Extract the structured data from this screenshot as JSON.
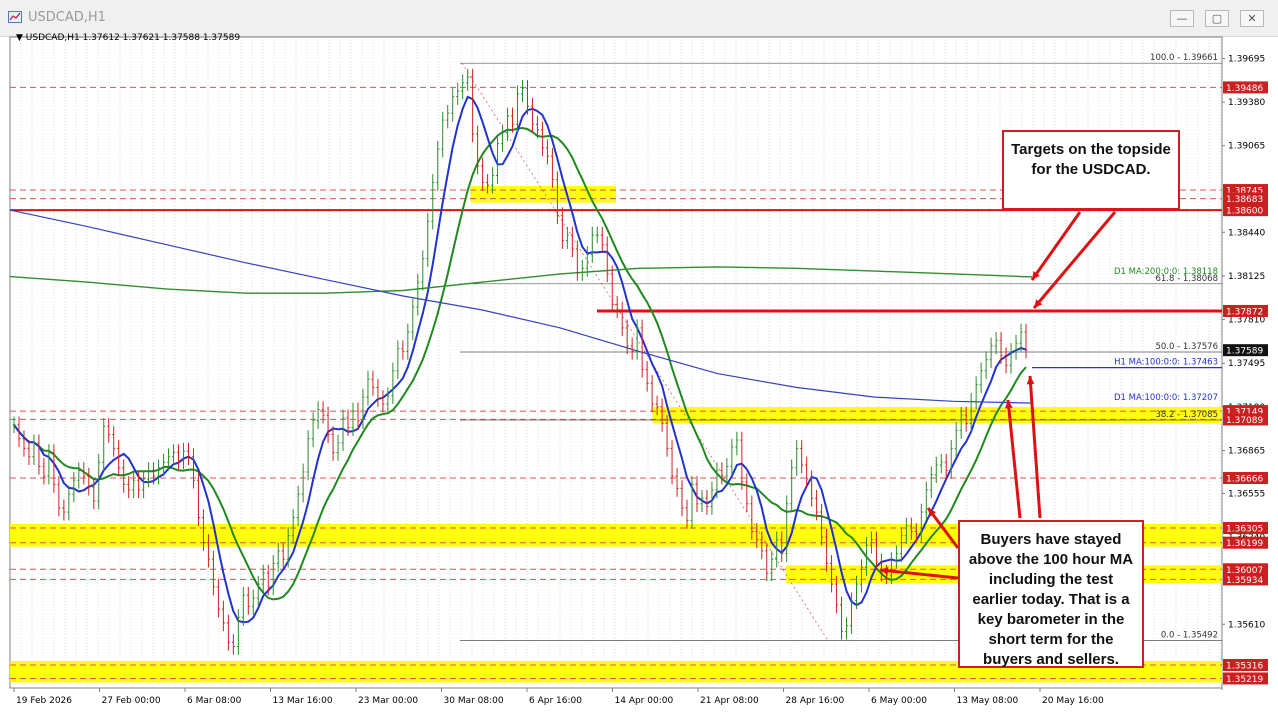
{
  "window": {
    "title": "USDCAD,H1",
    "minimize_label": "—",
    "maximize_label": "▢",
    "close_label": "✕",
    "icon": "chart-window-icon"
  },
  "symbol_header": "▼  USDCAD,H1  1.37612 1.37621 1.37588 1.37589",
  "chart_data": {
    "type": "line",
    "instrument": "USDCAD",
    "timeframe": "H1",
    "price_range": [
      1.3515,
      1.3985
    ],
    "current_price": "1.37589",
    "x_tick_labels": [
      "19 Feb 2026",
      "27 Feb 00:00",
      "6 Mar 08:00",
      "13 Mar 16:00",
      "23 Mar 00:00",
      "30 Mar 08:00",
      "6 Apr 16:00",
      "14 Apr 00:00",
      "21 Apr 08:00",
      "28 Apr 16:00",
      "6 May 00:00",
      "13 May 08:00",
      "20 May 16:00"
    ],
    "y_tick_labels": [
      "1.39695",
      "1.39380",
      "1.39065",
      "1.38440",
      "1.38125",
      "1.37810",
      "1.37495",
      "1.37180",
      "1.36865",
      "1.36555",
      "1.36240",
      "1.35610"
    ],
    "level_labels": [
      {
        "price": 1.39486,
        "text": "1.39486",
        "color": "#cc1f1f"
      },
      {
        "price": 1.38745,
        "text": "1.38745",
        "color": "#cc1f1f"
      },
      {
        "price": 1.38683,
        "text": "1.38683",
        "color": "#cc1f1f"
      },
      {
        "price": 1.386,
        "text": "1.38600",
        "color": "#cc1f1f"
      },
      {
        "price": 1.37872,
        "text": "1.37872",
        "color": "#cc1f1f"
      },
      {
        "price": 1.37149,
        "text": "1.37149",
        "color": "#cc1f1f"
      },
      {
        "price": 1.37089,
        "text": "1.37089",
        "color": "#cc1f1f"
      },
      {
        "price": 1.36666,
        "text": "1.36666",
        "color": "#cc1f1f"
      },
      {
        "price": 1.36305,
        "text": "1.36305",
        "color": "#cc1f1f"
      },
      {
        "price": 1.36199,
        "text": "1.36199",
        "color": "#cc1f1f"
      },
      {
        "price": 1.36007,
        "text": "1.36007",
        "color": "#cc1f1f"
      },
      {
        "price": 1.35934,
        "text": "1.35934",
        "color": "#cc1f1f"
      },
      {
        "price": 1.35316,
        "text": "1.35316",
        "color": "#cc1f1f"
      },
      {
        "price": 1.35219,
        "text": "1.35219",
        "color": "#cc1f1f"
      }
    ],
    "current_price_label": "1.37589",
    "solid_red_levels": [
      1.386,
      1.37872
    ],
    "dashed_red_levels": [
      1.39486,
      1.38745,
      1.38683,
      1.37149,
      1.37089,
      1.36666,
      1.36305,
      1.36199,
      1.36007,
      1.35934,
      1.35316,
      1.35219
    ],
    "yellow_zones": [
      {
        "from": 1.38683,
        "to": 1.38745,
        "start_index": 0.38,
        "end_index": 0.5
      },
      {
        "from": 1.37089,
        "to": 1.37149,
        "start_index": 0.53,
        "end_index": 1.0
      },
      {
        "from": 1.36199,
        "to": 1.36305,
        "start_index": 0.0,
        "end_index": 1.0
      },
      {
        "from": 1.35934,
        "to": 1.36007,
        "start_index": 0.64,
        "end_index": 1.0
      },
      {
        "from": 1.35219,
        "to": 1.35316,
        "start_index": 0.0,
        "end_index": 1.0
      }
    ],
    "fibonacci": [
      {
        "label": "100.0 - 1.39661",
        "price": 1.39661
      },
      {
        "label": "61.8 - 1.38068",
        "price": 1.38068
      },
      {
        "label": "50.0 - 1.37576",
        "price": 1.37576
      },
      {
        "label": "38.2 - 1.37085",
        "price": 1.37085
      },
      {
        "label": "0.0 - 1.35492",
        "price": 1.35492
      }
    ],
    "ma_labels": [
      {
        "label": "D1 MA:200:0:0: 1.38118",
        "price": 1.38118,
        "color": "#1e8a1e"
      },
      {
        "label": "H1 MA:100:0:0: 1.37463",
        "price": 1.37463,
        "color": "#2233cc"
      },
      {
        "label": "D1 MA:100:0:0: 1.37207",
        "price": 1.37207,
        "color": "#2233cc"
      }
    ],
    "close_series": [
      1.3705,
      1.3695,
      1.3688,
      1.3682,
      1.3692,
      1.3675,
      1.3668,
      1.3685,
      1.3662,
      1.3645,
      1.3642,
      1.3655,
      1.3665,
      1.3672,
      1.3668,
      1.366,
      1.365,
      1.3678,
      1.3704,
      1.3698,
      1.3688,
      1.3674,
      1.3662,
      1.3658,
      1.3665,
      1.3658,
      1.3666,
      1.3672,
      1.3668,
      1.3674,
      1.3678,
      1.3682,
      1.3685,
      1.3679,
      1.3686,
      1.3682,
      1.3665,
      1.3638,
      1.362,
      1.3608,
      1.3588,
      1.3572,
      1.3562,
      1.3548,
      1.3545,
      1.3566,
      1.3582,
      1.3574,
      1.358,
      1.359,
      1.3598,
      1.3588,
      1.3605,
      1.3614,
      1.3608,
      1.3625,
      1.3638,
      1.3655,
      1.3671,
      1.3695,
      1.3708,
      1.3716,
      1.3712,
      1.3698,
      1.3685,
      1.3692,
      1.371,
      1.3703,
      1.3715,
      1.3708,
      1.3725,
      1.3738,
      1.3732,
      1.3724,
      1.372,
      1.3726,
      1.3744,
      1.376,
      1.3758,
      1.3772,
      1.379,
      1.3808,
      1.3825,
      1.3852,
      1.388,
      1.3904,
      1.3925,
      1.393,
      1.3942,
      1.3946,
      1.3952,
      1.3956,
      1.3915,
      1.3892,
      1.388,
      1.3878,
      1.3885,
      1.3908,
      1.3916,
      1.3928,
      1.3922,
      1.3944,
      1.3948,
      1.3935,
      1.3922,
      1.3918,
      1.3905,
      1.3899,
      1.3882,
      1.3856,
      1.3838,
      1.3842,
      1.3832,
      1.3815,
      1.3818,
      1.3828,
      1.3842,
      1.3842,
      1.3835,
      1.3814,
      1.3792,
      1.3788,
      1.3775,
      1.3762,
      1.3758,
      1.3775,
      1.3745,
      1.3735,
      1.372,
      1.3718,
      1.3706,
      1.3688,
      1.3668,
      1.3659,
      1.3645,
      1.3636,
      1.3662,
      1.3648,
      1.3652,
      1.3646,
      1.3658,
      1.3672,
      1.3668,
      1.3675,
      1.3689,
      1.3694,
      1.3664,
      1.3648,
      1.3628,
      1.3622,
      1.3614,
      1.3598,
      1.3608,
      1.3622,
      1.3612,
      1.3648,
      1.3674,
      1.3688,
      1.3676,
      1.3666,
      1.3652,
      1.3642,
      1.3624,
      1.3605,
      1.359,
      1.3575,
      1.3556,
      1.356,
      1.3578,
      1.359,
      1.3602,
      1.3618,
      1.3622,
      1.3606,
      1.3598,
      1.3596,
      1.3607,
      1.3612,
      1.3625,
      1.3632,
      1.3628,
      1.3626,
      1.3642,
      1.3658,
      1.3669,
      1.3676,
      1.3678,
      1.3672,
      1.3688,
      1.3701,
      1.3712,
      1.3706,
      1.3722,
      1.3734,
      1.3744,
      1.3752,
      1.3762,
      1.3766,
      1.3755,
      1.3748,
      1.3758,
      1.3764,
      1.3772,
      1.3759
    ],
    "annotations": [
      {
        "text": "Targets on the topside for the USDCAD."
      },
      {
        "text": "Buyers have stayed above the 100 hour MA including the test earlier today.  That is a key barometer in the short term for the buyers and sellers."
      }
    ]
  }
}
